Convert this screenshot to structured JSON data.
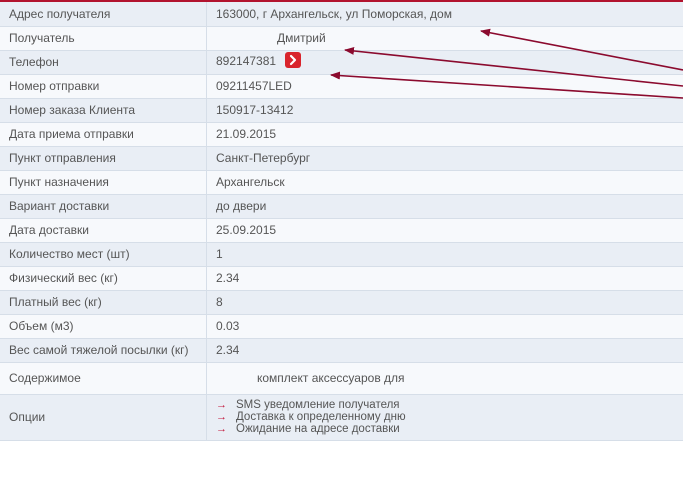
{
  "rows": [
    {
      "label": "Адрес получателя",
      "value": "163000, г Архангельск, ул Поморская, дом"
    },
    {
      "label": "Получатель",
      "value": "Дмитрий"
    },
    {
      "label": "Телефон",
      "value": "892147381"
    },
    {
      "label": "Номер отправки",
      "value": "09211457LED"
    },
    {
      "label": "Номер заказа Клиента",
      "value": "150917-13412"
    },
    {
      "label": "Дата приема отправки",
      "value": "21.09.2015"
    },
    {
      "label": "Пункт отправления",
      "value": "Санкт-Петербург"
    },
    {
      "label": "Пункт назначения",
      "value": "Архангельск"
    },
    {
      "label": "Вариант доставки",
      "value": "до двери"
    },
    {
      "label": "Дата доставки",
      "value": "25.09.2015"
    },
    {
      "label": "Количество мест (шт)",
      "value": "1"
    },
    {
      "label": "Физический вес (кг)",
      "value": "2.34"
    },
    {
      "label": "Платный вес (кг)",
      "value": "8"
    },
    {
      "label": "Объем (м3)",
      "value": "0.03"
    },
    {
      "label": "Вес самой тяжелой посылки (кг)",
      "value": "2.34"
    },
    {
      "label": "Содержимое",
      "value": "комплект аксессуаров для"
    },
    {
      "label": "Опции",
      "options": [
        "SMS уведомление получателя",
        "Доставка к определенному дню",
        "Ожидание на адресе доставки"
      ]
    }
  ],
  "option_arrow": "→",
  "colors": {
    "accent": "#b2132e",
    "button": "#d9242c",
    "row_odd": "#e9eef5",
    "row_even": "#f7f9fc"
  }
}
